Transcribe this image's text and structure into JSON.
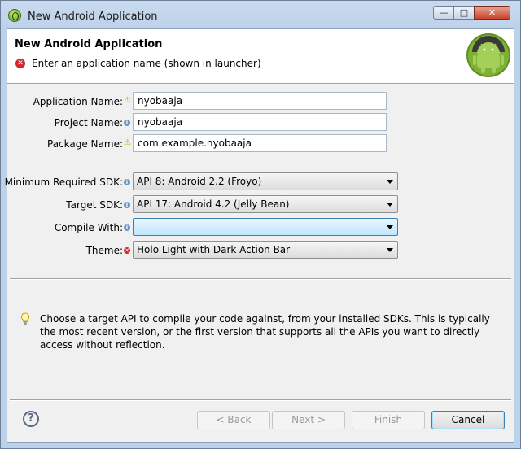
{
  "window": {
    "title": "New Android Application",
    "controls": {
      "minimize": "—",
      "maximize": "□",
      "close": "✕"
    }
  },
  "banner": {
    "title": "New Android Application",
    "message": "Enter an application name (shown in launcher)",
    "icon": "error-icon",
    "logo": "android-logo"
  },
  "form": {
    "application_name": {
      "label": "Application Name:",
      "value": "nyobaaja",
      "marker": "warning"
    },
    "project_name": {
      "label": "Project Name:",
      "value": "nyobaaja",
      "marker": "info"
    },
    "package_name": {
      "label": "Package Name:",
      "value": "com.example.nyobaaja",
      "marker": "warning"
    },
    "min_sdk": {
      "label": "Minimum Required SDK:",
      "value": "API 8: Android 2.2 (Froyo)",
      "marker": "info"
    },
    "target_sdk": {
      "label": "Target SDK:",
      "value": "API 17: Android 4.2 (Jelly Bean)",
      "marker": "info"
    },
    "compile_with": {
      "label": "Compile With:",
      "value": "",
      "marker": "info"
    },
    "theme": {
      "label": "Theme:",
      "value": "Holo Light with Dark Action Bar",
      "marker": "error"
    }
  },
  "hint": {
    "icon": "lightbulb-icon",
    "text": "Choose a target API to compile your code against, from your installed SDKs. This is typically the most recent version, or the first version that supports all the APIs you want to directly access without reflection."
  },
  "buttons": {
    "help": "?",
    "back": "< Back",
    "next": "Next >",
    "finish": "Finish",
    "cancel": "Cancel"
  },
  "colors": {
    "error": "#d4262b",
    "info": "#6d92c9",
    "warning": "#e0a000",
    "active_combo": "#bee6fd"
  }
}
